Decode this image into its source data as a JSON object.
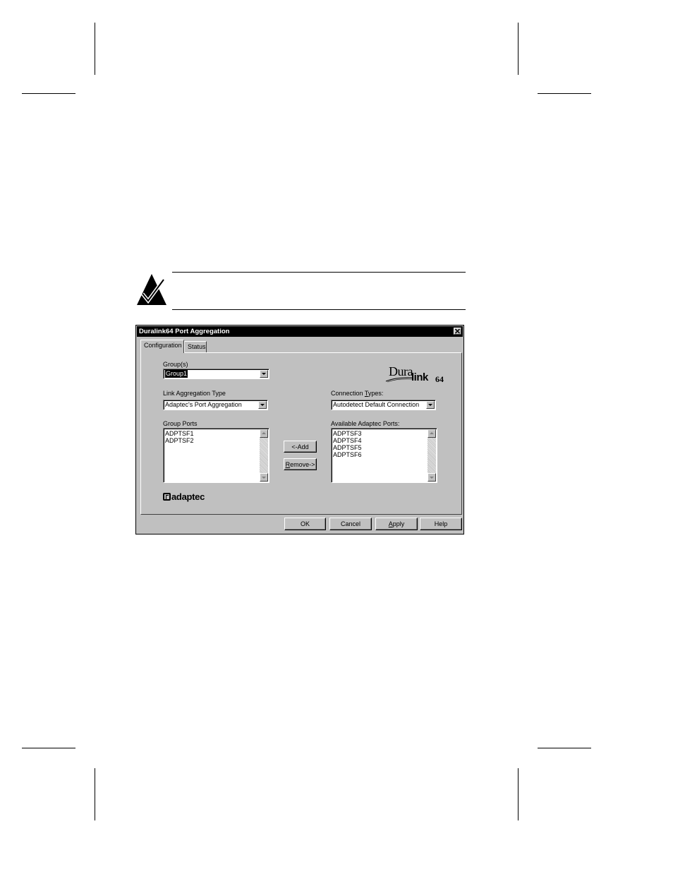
{
  "window": {
    "title": "Duralink64 Port Aggregation"
  },
  "tabs": [
    {
      "label": "Configuration",
      "active": true
    },
    {
      "label": "Status",
      "active": false
    }
  ],
  "groups": {
    "label": "Group(s)",
    "value": "Group1"
  },
  "link_aggregation_type": {
    "label": "Link Aggregation Type",
    "value": "Adaptec's Port Aggregation"
  },
  "connection_types": {
    "label_pre": "Connection ",
    "label_underlined": "T",
    "label_post": "ypes:",
    "value": "Autodetect Default Connection"
  },
  "group_ports": {
    "label": "Group Ports",
    "items": [
      "ADPTSF1",
      "ADPTSF2"
    ]
  },
  "available_ports": {
    "label": "Available Adaptec Ports:",
    "items": [
      "ADPTSF3",
      "ADPTSF4",
      "ADPTSF5",
      "ADPTSF6"
    ]
  },
  "buttons": {
    "add": "<-Add",
    "remove_underlined": "R",
    "remove_rest": "emove->",
    "ok": "OK",
    "cancel": "Cancel",
    "apply_underlined": "A",
    "apply_rest": "pply",
    "help": "Help"
  },
  "logos": {
    "dura": "Dura",
    "link": "link",
    "sixtyfour": "64",
    "adaptec": "adaptec"
  }
}
